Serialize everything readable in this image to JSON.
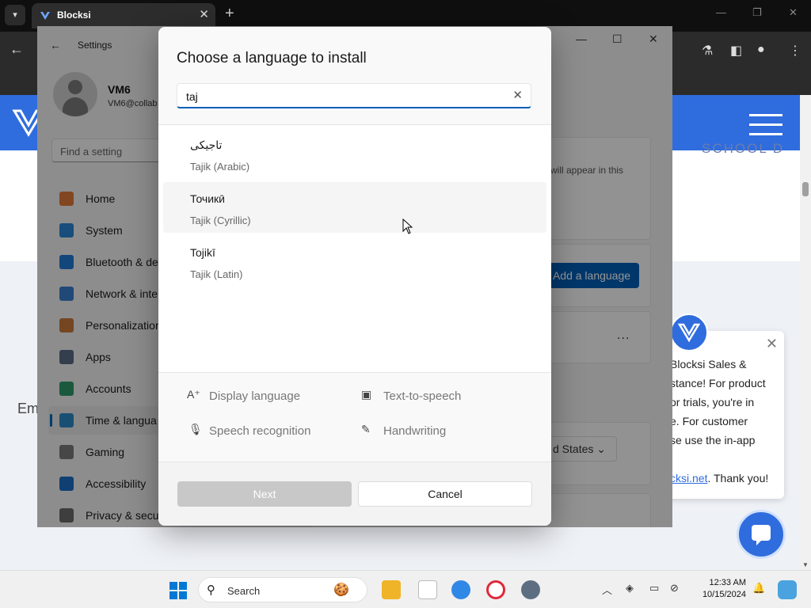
{
  "browser": {
    "tab_title": "Blocksi",
    "tab_close": "✕",
    "new_tab": "+"
  },
  "page": {
    "school_text": "SCHOOL D",
    "em_text": "Em",
    "chat": {
      "line1": "Blocksi Sales &",
      "line2": "stance! For product",
      "line3": "or trials, you're in",
      "line4": "e. For customer",
      "line5": "se use the in-app",
      "link": "cksi.net",
      "line6_after": ". Thank you!"
    }
  },
  "settings": {
    "title": "Settings",
    "user_name": "VM6",
    "user_email": "VM6@collab",
    "find_placeholder": "Find a setting",
    "nav": [
      {
        "label": "Home",
        "icon": "home-icon",
        "color": "#e07a3a"
      },
      {
        "label": "System",
        "icon": "system-icon",
        "color": "#2a86d6"
      },
      {
        "label": "Bluetooth & de",
        "icon": "bluetooth-icon",
        "color": "#1f7ad6"
      },
      {
        "label": "Network & inte",
        "icon": "network-icon",
        "color": "#3a7fcf"
      },
      {
        "label": "Personalization",
        "icon": "brush-icon",
        "color": "#c8793b"
      },
      {
        "label": "Apps",
        "icon": "apps-icon",
        "color": "#5b6b86"
      },
      {
        "label": "Accounts",
        "icon": "accounts-icon",
        "color": "#2e9a6b"
      },
      {
        "label": "Time & langua",
        "icon": "globe-icon",
        "color": "#2e89c9"
      },
      {
        "label": "Gaming",
        "icon": "gaming-icon",
        "color": "#7a7a7a"
      },
      {
        "label": "Accessibility",
        "icon": "accessibility-icon",
        "color": "#1d6fc7"
      },
      {
        "label": "Privacy & secu",
        "icon": "shield-icon",
        "color": "#6c6c6c"
      }
    ],
    "card_text": "will appear in this",
    "add_language": "Add a language",
    "more": "...",
    "region_value": "d States"
  },
  "dialog": {
    "title": "Choose a language to install",
    "search_value": "taj",
    "clear": "✕",
    "languages": [
      {
        "native": "تاجیکی",
        "name": "Tajik (Arabic)"
      },
      {
        "native": "Точикӣ",
        "name": "Tajik (Cyrillic)"
      },
      {
        "native": "Tojikī",
        "name": "Tajik (Latin)"
      }
    ],
    "features": {
      "display": "Display language",
      "tts": "Text-to-speech",
      "speech": "Speech recognition",
      "handwriting": "Handwriting"
    },
    "next": "Next",
    "cancel": "Cancel"
  },
  "taskbar": {
    "search_label": "Search",
    "time": "12:33 AM",
    "date": "10/15/2024"
  },
  "colors": {
    "accent": "#005fb8",
    "blocksi_blue": "#2f6cde"
  }
}
